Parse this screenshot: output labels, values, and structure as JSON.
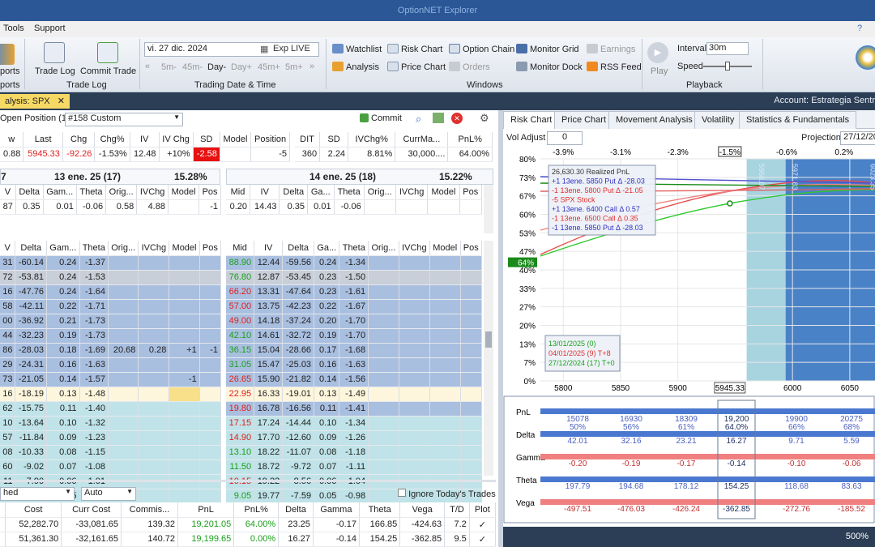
{
  "window": {
    "title": "OptionNET Explorer"
  },
  "menu": [
    "Tools",
    "Support"
  ],
  "ribbon": {
    "reports_label": "ports",
    "reports_group": "ports",
    "trade_log": "Trade Log",
    "commit_trade": "Commit Trade",
    "trade_log_group": "Trade Log",
    "date_value": "vi. 27 dic. 2024",
    "exp_live": "Exp LIVE",
    "steps": [
      "5m-",
      "45m-",
      "Day-",
      "Day+",
      "45m+",
      "5m+"
    ],
    "date_group": "Trading Date & Time",
    "watchlist": "Watchlist",
    "risk_chart": "Risk Chart",
    "option_chain": "Option Chain",
    "monitor_grid": "Monitor Grid",
    "earnings": "Earnings",
    "analysis": "Analysis",
    "price_chart": "Price Chart",
    "orders": "Orders",
    "monitor_dock": "Monitor Dock",
    "rss_feed": "RSS Feed",
    "windows_group": "Windows",
    "play": "Play",
    "interval_label": "Interval",
    "interval_value": "30m",
    "speed_label": "Speed",
    "playback_group": "Playback"
  },
  "doc_tab": {
    "label": "alysis: SPX",
    "close": "✕"
  },
  "account": "Account: Estrategia Sentr",
  "position_bar": {
    "open_position": "Open Position (1)",
    "custom": "#158 Custom",
    "commit": "Commit"
  },
  "underlying": {
    "headers": [
      "w",
      "Last",
      "Chg",
      "Chg%",
      "IV",
      "IV Chg",
      "SD",
      "Model",
      "Position"
    ],
    "values": [
      "0.88",
      "5945.33",
      "-92.26",
      "-1.53%",
      "12.48",
      "+10%",
      "-2.58",
      "",
      "-5"
    ]
  },
  "summary": {
    "headers": [
      "DIT",
      "SD",
      "IVChg%",
      "CurrMa...",
      "PnL%"
    ],
    "values": [
      "360",
      "2.24",
      "8.81%",
      "30,000....",
      "64.00%"
    ]
  },
  "exp_left": {
    "title": "13 ene. 25 (17)",
    "iv": "15.28%",
    "left_char": "7",
    "headers": [
      "V",
      "Delta",
      "Gam...",
      "Theta",
      "Orig...",
      "IVChg",
      "Model",
      "Pos"
    ],
    "row": [
      "87",
      "0.35",
      "0.01",
      "-0.06",
      "0.58",
      "4.88",
      "",
      "-1"
    ]
  },
  "exp_right": {
    "title": "14 ene. 25 (18)",
    "iv": "15.22%",
    "headers": [
      "Mid",
      "IV",
      "Delta",
      "Ga...",
      "Theta",
      "Orig...",
      "IVChg",
      "Model",
      "Pos"
    ],
    "row": [
      "0.20",
      "14.43",
      "0.35",
      "0.01",
      "-0.06",
      "",
      "",
      "",
      ""
    ]
  },
  "chain_left_headers": [
    "V",
    "Delta",
    "Gam...",
    "Theta",
    "Orig...",
    "IVChg",
    "Model",
    "Pos"
  ],
  "chain_right_headers": [
    "Mid",
    "IV",
    "Delta",
    "Ga...",
    "Theta",
    "Orig...",
    "IVChg",
    "Model",
    "Pos"
  ],
  "chain_left": [
    [
      "31",
      "-60.14",
      "0.24",
      "-1.37",
      "",
      "",
      "",
      ""
    ],
    [
      "72",
      "-53.81",
      "0.24",
      "-1.53",
      "",
      "",
      "",
      ""
    ],
    [
      "16",
      "-47.76",
      "0.24",
      "-1.64",
      "",
      "",
      "",
      ""
    ],
    [
      "58",
      "-42.11",
      "0.22",
      "-1.71",
      "",
      "",
      "",
      ""
    ],
    [
      "00",
      "-36.92",
      "0.21",
      "-1.73",
      "",
      "",
      "",
      ""
    ],
    [
      "44",
      "-32.23",
      "0.19",
      "-1.73",
      "",
      "",
      "",
      ""
    ],
    [
      "86",
      "-28.03",
      "0.18",
      "-1.69",
      "20.68",
      "0.28",
      "+1",
      "-1"
    ],
    [
      "29",
      "-24.31",
      "0.16",
      "-1.63",
      "",
      "",
      "",
      ""
    ],
    [
      "73",
      "-21.05",
      "0.14",
      "-1.57",
      "",
      "",
      "-1",
      ""
    ],
    [
      "16",
      "-18.19",
      "0.13",
      "-1.48",
      "",
      "",
      "",
      ""
    ],
    [
      "62",
      "-15.75",
      "0.11",
      "-1.40",
      "",
      "",
      "",
      ""
    ],
    [
      "10",
      "-13.64",
      "0.10",
      "-1.32",
      "",
      "",
      "",
      ""
    ],
    [
      "57",
      "-11.84",
      "0.09",
      "-1.23",
      "",
      "",
      "",
      ""
    ],
    [
      "08",
      "-10.33",
      "0.08",
      "-1.15",
      "",
      "",
      "",
      ""
    ],
    [
      "60",
      "-9.02",
      "0.07",
      "-1.08",
      "",
      "",
      "",
      ""
    ],
    [
      "11",
      "-7.90",
      "0.06",
      "-1.01",
      "",
      "",
      "",
      ""
    ],
    [
      "67",
      "-6.93",
      "0.05",
      "-0.94",
      "",
      "",
      "",
      ""
    ]
  ],
  "chain_right": [
    [
      "88.90",
      "12.44",
      "-59.56",
      "0.24",
      "-1.34"
    ],
    [
      "76.80",
      "12.87",
      "-53.45",
      "0.23",
      "-1.50"
    ],
    [
      "66.20",
      "13.31",
      "-47.64",
      "0.23",
      "-1.61"
    ],
    [
      "57.00",
      "13.75",
      "-42.23",
      "0.22",
      "-1.67"
    ],
    [
      "49.00",
      "14.18",
      "-37.24",
      "0.20",
      "-1.70"
    ],
    [
      "42.10",
      "14.61",
      "-32.72",
      "0.19",
      "-1.70"
    ],
    [
      "36.15",
      "15.04",
      "-28.66",
      "0.17",
      "-1.68"
    ],
    [
      "31.05",
      "15.47",
      "-25.03",
      "0.16",
      "-1.63"
    ],
    [
      "26.65",
      "15.90",
      "-21.82",
      "0.14",
      "-1.56"
    ],
    [
      "22.95",
      "16.33",
      "-19.01",
      "0.13",
      "-1.49"
    ],
    [
      "19.80",
      "16.78",
      "-16.56",
      "0.11",
      "-1.41"
    ],
    [
      "17.15",
      "17.24",
      "-14.44",
      "0.10",
      "-1.34"
    ],
    [
      "14.90",
      "17.70",
      "-12.60",
      "0.09",
      "-1.26"
    ],
    [
      "13.10",
      "18.22",
      "-11.07",
      "0.08",
      "-1.18"
    ],
    [
      "11.50",
      "18.72",
      "-9.72",
      "0.07",
      "-1.11"
    ],
    [
      "10.15",
      "19.22",
      "-8.56",
      "0.06",
      "-1.04"
    ],
    [
      "9.05",
      "19.77",
      "-7.59",
      "0.05",
      "-0.98"
    ]
  ],
  "bottom_controls": {
    "left_select": "hed",
    "auto_select": "Auto",
    "ignore": "Ignore Today's Trades"
  },
  "totals": {
    "headers": [
      "Cost",
      "Curr Cost",
      "Commis...",
      "PnL",
      "PnL%",
      "Delta",
      "Gamma",
      "Theta",
      "Vega",
      "T/D",
      "Plot"
    ],
    "rows": [
      [
        "52,282.70",
        "-33,081.65",
        "139.32",
        "19,201.05",
        "64.00%",
        "23.25",
        "-0.17",
        "166.85",
        "-424.63",
        "7.2",
        "✓"
      ],
      [
        "51,361.30",
        "-32,161.65",
        "140.72",
        "19,199.65",
        "0.00%",
        "16.27",
        "-0.14",
        "154.25",
        "-362.85",
        "9.5",
        "✓"
      ]
    ]
  },
  "right_tabs": [
    "Risk Chart",
    "Price Chart",
    "Movement Analysis",
    "Volatility",
    "Statistics & Fundamentals"
  ],
  "vol_adjust": {
    "label": "Vol Adjust",
    "value": "0",
    "projection_label": "Projection",
    "projection_value": "27/12/20"
  },
  "chart_data": {
    "type": "line",
    "top_pct": [
      "-3.9%",
      "-3.1%",
      "-2.3%",
      "-1.5%",
      "-0.6%",
      "0.2%"
    ],
    "x": [
      5800,
      5850,
      5900,
      5945.33,
      6000,
      6050
    ],
    "x_labels": [
      "5800",
      "5850",
      "5900",
      "5945.33",
      "6000",
      "6050"
    ],
    "y_labels": [
      "80%",
      "73%",
      "67%",
      "60%",
      "53%",
      "47%",
      "40%",
      "33%",
      "27%",
      "20%",
      "13%",
      "7%",
      "0%"
    ],
    "current_y": "64%",
    "legend": [
      {
        "text": "26,630.30 Realized PnL",
        "color": "#333333"
      },
      {
        "text": "+1 13ene. 5850 Put Δ   -28.03",
        "color": "#3030c0"
      },
      {
        "text": "-1 13ene. 5800 Put Δ   -21.05",
        "color": "#e03030"
      },
      {
        "text": "-5 SPX Stock",
        "color": "#e03030"
      },
      {
        "text": "+1 13ene. 6400 Call Δ   0.57",
        "color": "#3030c0"
      },
      {
        "text": "-1 13ene. 6500 Call Δ   0.35",
        "color": "#e03030"
      },
      {
        "text": "-1 13ene. 5850 Put Δ   -28.03",
        "color": "#3030c0"
      }
    ],
    "dates": [
      {
        "text": "13/01/2025 (0)",
        "color": "#1aa01a"
      },
      {
        "text": "04/01/2025 (9) T+8",
        "color": "#e03030"
      },
      {
        "text": "27/12/2024 (17) T+0",
        "color": "#1aa01a"
      }
    ],
    "side_labels": [
      "5966.07",
      "5971.83",
      "6023.35"
    ]
  },
  "greeks": {
    "rows": [
      {
        "label": "PnL",
        "values": [
          "15078",
          "16930",
          "18309",
          "19,200",
          "19900",
          "20275"
        ],
        "pct": [
          "50%",
          "56%",
          "61%",
          "64.0%",
          "66%",
          "68%"
        ]
      },
      {
        "label": "Delta",
        "values": [
          "42.01",
          "32.16",
          "23.21",
          "16.27",
          "9.71",
          "5.59"
        ]
      },
      {
        "label": "Gamma",
        "values": [
          "-0.20",
          "-0.19",
          "-0.17",
          "-0.14",
          "-0.10",
          "-0.06"
        ]
      },
      {
        "label": "Theta",
        "values": [
          "197.79",
          "194.68",
          "178.12",
          "154.25",
          "118.68",
          "83.63"
        ]
      },
      {
        "label": "Vega",
        "values": [
          "-497.51",
          "-476.03",
          "-426.24",
          "-362.85",
          "-272.76",
          "-185.52"
        ]
      }
    ]
  },
  "zoom": "500%"
}
